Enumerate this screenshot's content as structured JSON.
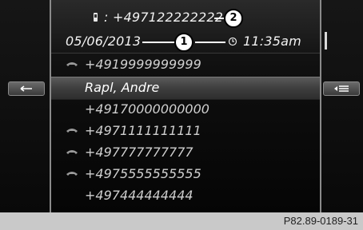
{
  "header": {
    "number": "+497122222222",
    "date": "05/06/2013",
    "time": "11:35am",
    "callout_1": "1",
    "callout_2": "2"
  },
  "list": {
    "items": [
      {
        "label": "+4919999999999",
        "icon": "phone-icon",
        "selected": false
      },
      {
        "label": "Rapl, Andre",
        "icon": "",
        "selected": true
      },
      {
        "label": "+49170000000000",
        "icon": "",
        "selected": false
      },
      {
        "label": "+4971111111111",
        "icon": "phone-icon",
        "selected": false
      },
      {
        "label": "+497777777777",
        "icon": "phone-icon",
        "selected": false
      },
      {
        "label": "+4975555555555",
        "icon": "phone-icon",
        "selected": false
      },
      {
        "label": "+497444444444",
        "icon": "",
        "selected": false
      }
    ]
  },
  "side": {
    "left_button_icon": "back-icon",
    "right_button_icon": "list-menu-icon"
  },
  "footer": {
    "ref": "P82.89-0189-31"
  }
}
